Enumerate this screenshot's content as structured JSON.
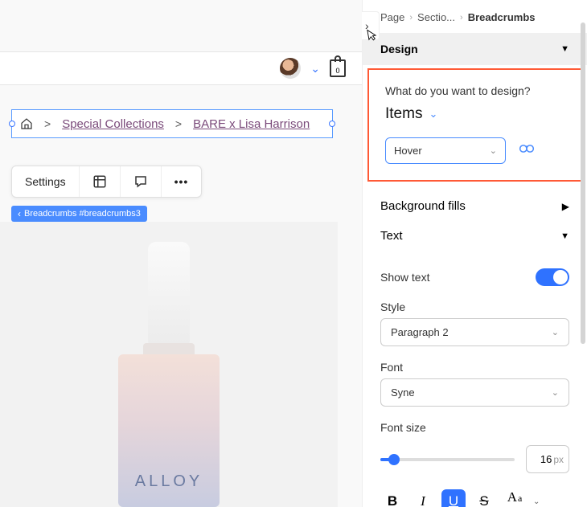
{
  "site_header": {
    "bag_count": "0"
  },
  "breadcrumb_preview": {
    "home_label": "Home",
    "item1": "Special Collections",
    "item2": "BARE x Lisa Harrison"
  },
  "floating_toolbar": {
    "settings": "Settings"
  },
  "selection_tag": "Breadcrumbs #breadcrumbs3",
  "product": {
    "brand": "ALLOY"
  },
  "panel_breadcrumb": {
    "page": "Page",
    "section": "Sectio...",
    "current": "Breadcrumbs"
  },
  "sections": {
    "design": "Design",
    "background_fills": "Background fills",
    "text": "Text"
  },
  "design_panel": {
    "question": "What do you want to design?",
    "target": "Items",
    "state": "Hover"
  },
  "text_panel": {
    "show_text": "Show text",
    "style_label": "Style",
    "style_value": "Paragraph 2",
    "font_label": "Font",
    "font_value": "Syne",
    "fontsize_label": "Font size",
    "fontsize_value": "16",
    "fontsize_unit": "px"
  },
  "format": {
    "bold": "B",
    "italic": "I",
    "underline": "U",
    "strike": "S",
    "case_big": "A",
    "case_small": "a"
  }
}
